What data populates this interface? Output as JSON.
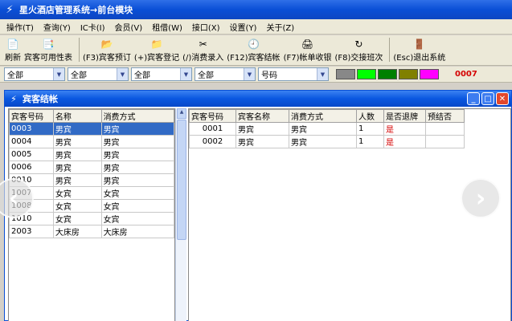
{
  "app": {
    "title": "星火酒店管理系统→前台模块"
  },
  "menu": [
    "操作(T)",
    "查询(Y)",
    "IC卡(I)",
    "会员(V)",
    "租借(W)",
    "接口(X)",
    "设置(Y)",
    "关于(Z)"
  ],
  "toolbar": {
    "buttons": [
      {
        "label": "刷新",
        "icon": "📄"
      },
      {
        "label": "宾客可用性表",
        "icon": "📑"
      },
      {
        "label": "(F3)宾客预订",
        "icon": "📂"
      },
      {
        "label": "(+)宾客登记",
        "icon": "📁"
      },
      {
        "label": "(/)消费录入",
        "icon": "✂"
      },
      {
        "label": "(F12)宾客结帐",
        "icon": "🕘"
      },
      {
        "label": "(F7)帐单收银",
        "icon": "🖨"
      },
      {
        "label": "(F8)交接班次",
        "icon": "↻"
      },
      {
        "label": "(Esc)退出系统",
        "icon": "🚪"
      }
    ]
  },
  "filters": {
    "combos": [
      "全部",
      "全部",
      "全部",
      "全部",
      "号码"
    ],
    "swatches": [
      "#888888",
      "#00ff00",
      "#008000",
      "#808000",
      "#ff00ff"
    ],
    "counter": "0007"
  },
  "child": {
    "title": "宾客结帐",
    "left_headers": [
      "宾客号码",
      "名称",
      "消费方式"
    ],
    "left_rows": [
      [
        "0003",
        "男宾",
        "男宾"
      ],
      [
        "0004",
        "男宾",
        "男宾"
      ],
      [
        "0005",
        "男宾",
        "男宾"
      ],
      [
        "0006",
        "男宾",
        "男宾"
      ],
      [
        "0010",
        "男宾",
        "男宾"
      ],
      [
        "1007",
        "女宾",
        "女宾"
      ],
      [
        "1008",
        "女宾",
        "女宾"
      ],
      [
        "1010",
        "女宾",
        "女宾"
      ],
      [
        "2003",
        "大床房",
        "大床房"
      ]
    ],
    "right_headers": [
      "宾客号码",
      "宾客名称",
      "消费方式",
      "人数",
      "是否退牌",
      "预结否"
    ],
    "right_rows": [
      [
        "0001",
        "男宾",
        "男宾",
        "1",
        "是",
        ""
      ],
      [
        "0002",
        "男宾",
        "男宾",
        "1",
        "是",
        ""
      ]
    ]
  },
  "icons": {
    "app_logo": "⚡",
    "minimize": "_",
    "maximize": "□",
    "close": "✕",
    "nav_prev": "‹",
    "nav_next": "›"
  }
}
